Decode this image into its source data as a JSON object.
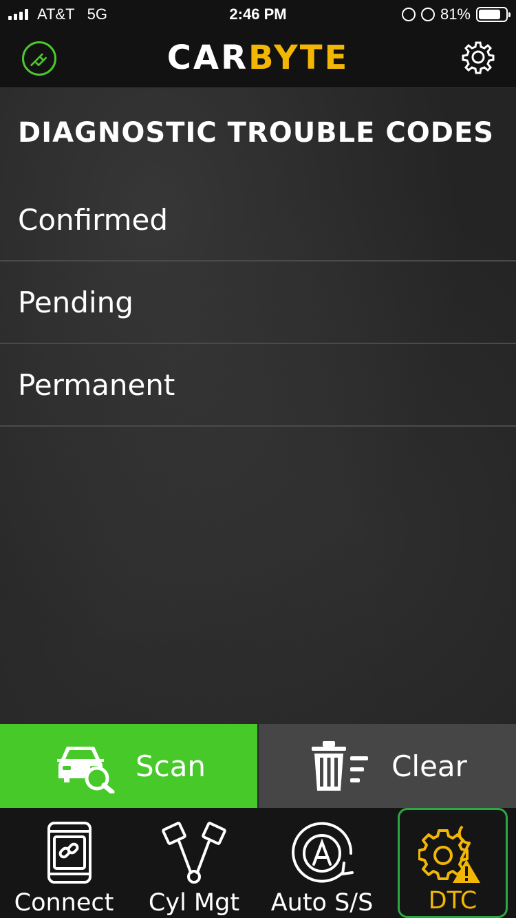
{
  "status_bar": {
    "carrier": "AT&T",
    "network": "5G",
    "time": "2:46 PM",
    "battery_percent": "81%",
    "battery_level": 0.81
  },
  "header": {
    "brand_part1": "CAR",
    "brand_part2": "BYTE",
    "left_icon": "power-plug-icon",
    "right_icon": "gear-icon"
  },
  "main": {
    "title": "DIAGNOSTIC TROUBLE CODES",
    "items": [
      {
        "label": "Confirmed"
      },
      {
        "label": "Pending"
      },
      {
        "label": "Permanent"
      }
    ]
  },
  "actions": {
    "scan_label": "Scan",
    "clear_label": "Clear"
  },
  "tabs": [
    {
      "label": "Connect",
      "icon": "phone-link-icon"
    },
    {
      "label": "Cyl Mgt",
      "icon": "pistons-icon"
    },
    {
      "label": "Auto S/S",
      "icon": "auto-start-stop-icon"
    },
    {
      "label": "DTC",
      "icon": "engine-warning-icon",
      "active": true
    }
  ],
  "colors": {
    "accent_green": "#47c92a",
    "brand_yellow": "#f2b705",
    "active_tab_border": "#2ea843",
    "clear_button": "#464646"
  }
}
